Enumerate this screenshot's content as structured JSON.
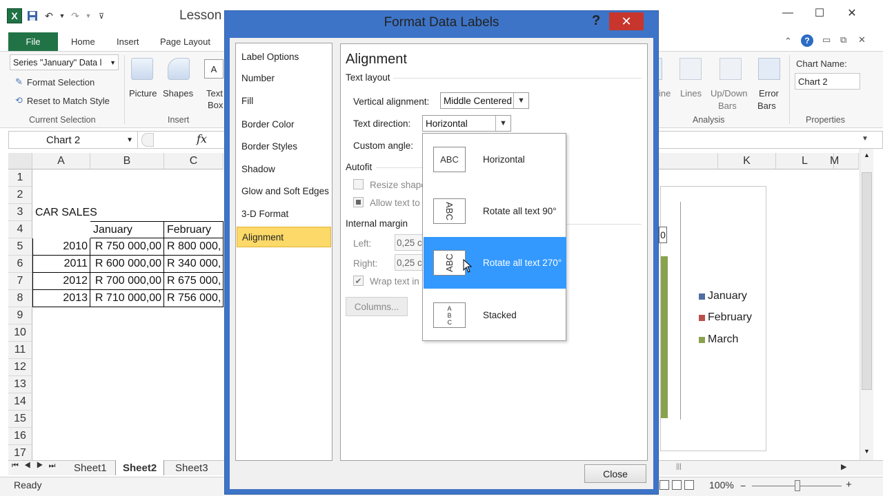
{
  "window": {
    "doc_title": "Lesson",
    "logo": "X",
    "controls": {
      "minimize": "—",
      "restore": "☐",
      "close": "✕"
    }
  },
  "ribbon": {
    "tabs": [
      "File",
      "Home",
      "Insert",
      "Page Layout"
    ],
    "current_selection": {
      "series_select": "Series \"January\" Data l",
      "format_selection": "Format Selection",
      "reset_style": "Reset to Match Style",
      "group_label": "Current Selection"
    },
    "insert_group": {
      "picture": "Picture",
      "shapes": "Shapes",
      "text_box_1": "Text",
      "text_box_2": "Box",
      "group_label": "Insert"
    },
    "analysis_group": {
      "trendline_partial": "ine",
      "lines": "Lines",
      "updown_1": "Up/Down",
      "updown_2": "Bars",
      "error_1": "Error",
      "error_2": "Bars",
      "group_label": "Analysis"
    },
    "properties_group": {
      "chart_name_label": "Chart Name:",
      "chart_name_value": "Chart 2",
      "group_label": "Properties"
    }
  },
  "formula_bar": {
    "name_box": "Chart 2",
    "fx": "fx"
  },
  "sheet": {
    "col_headers_left": [
      "A",
      "B",
      "C"
    ],
    "col_headers_right": [
      "K",
      "L",
      "M"
    ],
    "row_numbers": [
      "1",
      "2",
      "3",
      "4",
      "5",
      "6",
      "7",
      "8",
      "9",
      "10",
      "11",
      "12",
      "13",
      "14",
      "15",
      "16",
      "17"
    ],
    "title": "CAR SALES",
    "header_jan": "January",
    "header_feb": "February",
    "rows": [
      {
        "year": "2010",
        "jan": "R 750 000,00",
        "feb": "R 800 000,"
      },
      {
        "year": "2011",
        "jan": "R 600 000,00",
        "feb": "R 340 000,"
      },
      {
        "year": "2012",
        "jan": "R 700 000,00",
        "feb": "R 675 000,"
      },
      {
        "year": "2013",
        "jan": "R 710 000,00",
        "feb": "R 756 000,"
      }
    ],
    "tabs": [
      "Sheet1",
      "Sheet2",
      "Sheet3"
    ],
    "active_tab": "Sheet2"
  },
  "chart": {
    "label_partial": "0",
    "legend": [
      {
        "name": "January",
        "color": "#4f6fa3"
      },
      {
        "name": "February",
        "color": "#b9504c"
      },
      {
        "name": "March",
        "color": "#8aa24d"
      }
    ]
  },
  "status": {
    "ready": "Ready",
    "zoom": "100%"
  },
  "dialog": {
    "title": "Format Data Labels",
    "help": "?",
    "categories": [
      "Label Options",
      "Number",
      "Fill",
      "Border Color",
      "Border Styles",
      "Shadow",
      "Glow and Soft Edges",
      "3-D Format",
      "Alignment"
    ],
    "selected_category": "Alignment",
    "panel": {
      "heading": "Alignment",
      "text_layout": "Text layout",
      "vertical_alignment_label": "Vertical alignment:",
      "vertical_alignment_value": "Middle Centered",
      "text_direction_label": "Text direction:",
      "text_direction_value": "Horizontal",
      "custom_angle_label": "Custom angle:",
      "autofit": "Autofit",
      "resize_shape": "Resize shape",
      "allow_overflow": "Allow text to",
      "internal_margin": "Internal margin",
      "left_label": "Left:",
      "left_value": "0,25 c",
      "right_label": "Right:",
      "right_value": "0,25 c",
      "wrap_text": "Wrap text in",
      "columns_button": "Columns..."
    },
    "dropdown": [
      {
        "icon": "ABC",
        "label": "Horizontal"
      },
      {
        "icon": "ABC",
        "label": "Rotate all text 90°"
      },
      {
        "icon": "ABC",
        "label": "Rotate all text 270°"
      },
      {
        "icon": "A B C",
        "label": "Stacked"
      }
    ],
    "highlighted_option": "Rotate all text 270°",
    "close_button": "Close"
  }
}
